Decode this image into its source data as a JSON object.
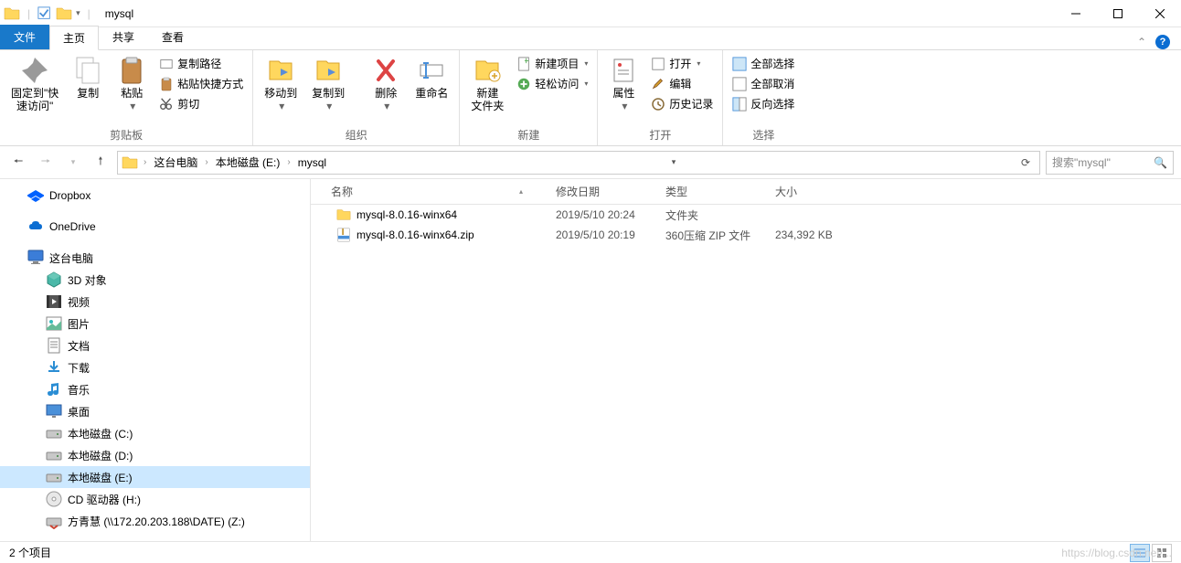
{
  "window": {
    "title": "mysql"
  },
  "tabs": {
    "file": "文件",
    "home": "主页",
    "share": "共享",
    "view": "查看"
  },
  "ribbon": {
    "clipboard": {
      "label": "剪贴板",
      "pin": "固定到\"快\n速访问\"",
      "copy": "复制",
      "paste": "粘贴",
      "copypath": "复制路径",
      "pasteshortcut": "粘贴快捷方式",
      "cut": "剪切"
    },
    "organize": {
      "label": "组织",
      "moveto": "移动到",
      "copyto": "复制到",
      "delete": "删除",
      "rename": "重命名"
    },
    "new": {
      "label": "新建",
      "newfolder": "新建\n文件夹",
      "newitem": "新建项目",
      "easyaccess": "轻松访问"
    },
    "open": {
      "label": "打开",
      "properties": "属性",
      "open": "打开",
      "edit": "编辑",
      "history": "历史记录"
    },
    "select": {
      "label": "选择",
      "selectall": "全部选择",
      "selectnone": "全部取消",
      "invert": "反向选择"
    }
  },
  "breadcrumbs": {
    "thispc": "这台电脑",
    "drive": "本地磁盘 (E:)",
    "folder": "mysql"
  },
  "search": {
    "placeholder": "搜索\"mysql\""
  },
  "navtree": {
    "dropbox": "Dropbox",
    "onedrive": "OneDrive",
    "thispc": "这台电脑",
    "objects3d": "3D 对象",
    "videos": "视频",
    "pictures": "图片",
    "documents": "文档",
    "downloads": "下载",
    "music": "音乐",
    "desktop": "桌面",
    "drivec": "本地磁盘 (C:)",
    "drived": "本地磁盘 (D:)",
    "drivee": "本地磁盘 (E:)",
    "driveh": "CD 驱动器 (H:)",
    "drivez": "方青慧 (\\\\172.20.203.188\\DATE) (Z:)"
  },
  "columns": {
    "name": "名称",
    "date": "修改日期",
    "type": "类型",
    "size": "大小"
  },
  "files": [
    {
      "name": "mysql-8.0.16-winx64",
      "date": "2019/5/10 20:24",
      "type": "文件夹",
      "size": "",
      "icon": "folder"
    },
    {
      "name": "mysql-8.0.16-winx64.zip",
      "date": "2019/5/10 20:19",
      "type": "360压缩 ZIP 文件",
      "size": "234,392 KB",
      "icon": "zip"
    }
  ],
  "status": {
    "count": "2 个项目"
  },
  "watermark": "https://blog.csdn.net/..."
}
